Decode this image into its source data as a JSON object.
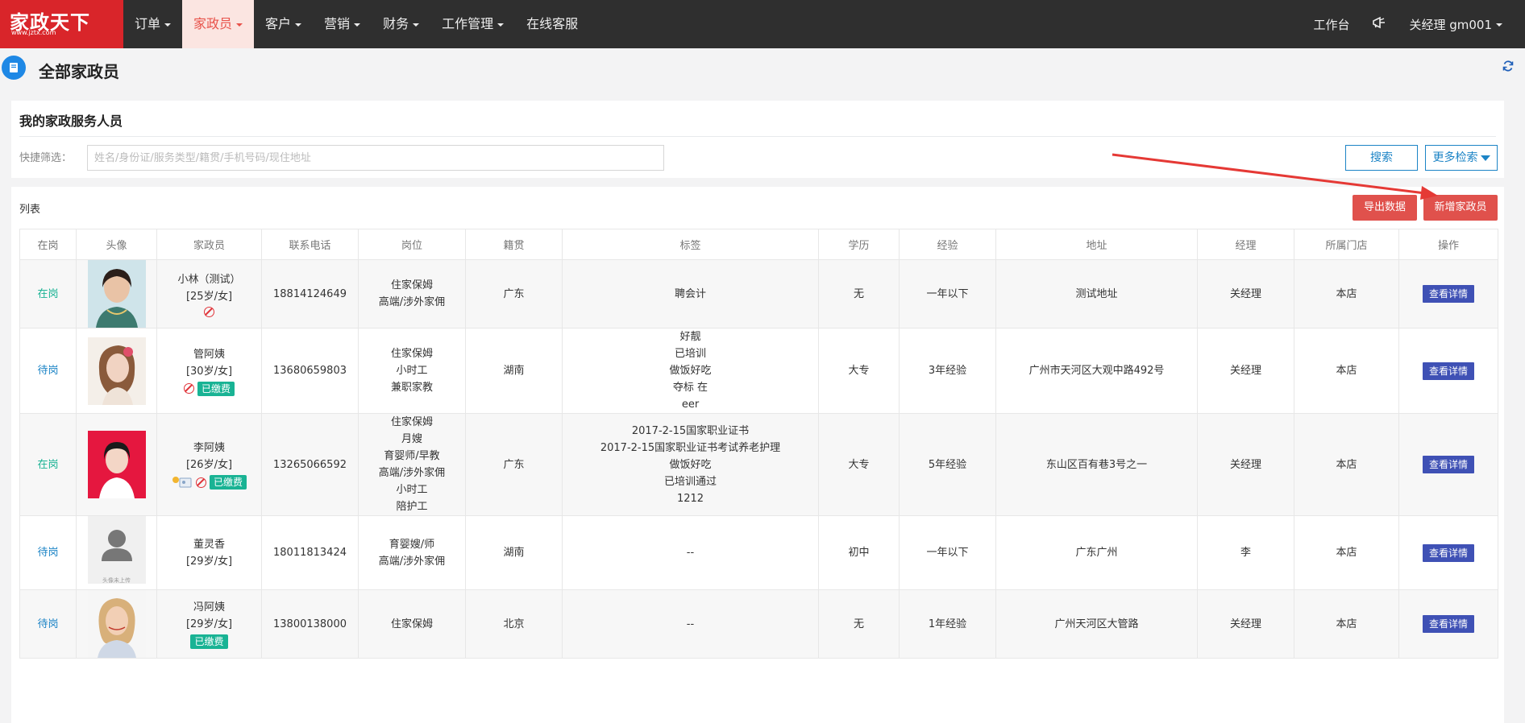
{
  "brand": {
    "logo_text": "家政天下",
    "logo_sub": "www.jztx.com",
    "colors": {
      "brand_red": "#d9252a",
      "nav_bg": "#2f2f2f",
      "accent_green": "#1ab394",
      "accent_blue": "#1c84c6",
      "detail_btn": "#3f51b5"
    }
  },
  "nav": {
    "items": [
      {
        "label": "订单",
        "dropdown": true
      },
      {
        "label": "家政员",
        "dropdown": true,
        "active": true
      },
      {
        "label": "客户",
        "dropdown": true
      },
      {
        "label": "营销",
        "dropdown": true
      },
      {
        "label": "财务",
        "dropdown": true
      },
      {
        "label": "工作管理",
        "dropdown": true
      },
      {
        "label": "在线客服",
        "dropdown": false
      }
    ],
    "right": {
      "workbench": "工作台",
      "bell_icon": "megaphone-icon",
      "user": "关经理 gm001"
    }
  },
  "page": {
    "title": "全部家政员",
    "icon": "book-icon",
    "refresh_icon": "refresh-icon"
  },
  "filter": {
    "title": "我的家政服务人员",
    "label": "快捷筛选：",
    "placeholder": "姓名/身份证/服务类型/籍贯/手机号码/现住地址",
    "search_btn": "搜索",
    "more_btn": "更多检索"
  },
  "list": {
    "label": "列表",
    "export_btn": "导出数据",
    "add_btn": "新增家政员",
    "columns": [
      "在岗",
      "头像",
      "家政员",
      "联系电话",
      "岗位",
      "籍贯",
      "标签",
      "学历",
      "经验",
      "地址",
      "经理",
      "所属门店",
      "操作"
    ],
    "rows": [
      {
        "status": "在岗",
        "name": "小林（测试）",
        "info": "[25岁/女]",
        "ban": true,
        "paid": "",
        "id_icon": false,
        "phone": "18814124649",
        "positions": [
          "住家保姆",
          "高端/涉外家佣"
        ],
        "origin": "广东",
        "tags": [
          "聘会计"
        ],
        "education": "无",
        "experience": "一年以下",
        "address": "测试地址",
        "manager": "关经理",
        "store": "本店",
        "action": "查看详情",
        "avatar": "woman-1"
      },
      {
        "status": "待岗",
        "name": "管阿姨",
        "info": "[30岁/女]",
        "ban": true,
        "paid": "已缴费",
        "id_icon": false,
        "phone": "13680659803",
        "positions": [
          "住家保姆",
          "小时工",
          "兼职家教"
        ],
        "origin": "湖南",
        "tags": [
          "好靓",
          "已培训",
          "做饭好吃",
          "夺标 在",
          "eer"
        ],
        "education": "大专",
        "experience": "3年经验",
        "address": "广州市天河区大观中路492号",
        "manager": "关经理",
        "store": "本店",
        "action": "查看详情",
        "avatar": "woman-2"
      },
      {
        "status": "在岗",
        "name": "李阿姨",
        "info": "[26岁/女]",
        "ban": true,
        "paid": "已缴费",
        "id_icon": true,
        "phone": "13265066592",
        "positions": [
          "住家保姆",
          "月嫂",
          "育婴师/早教",
          "高端/涉外家佣",
          "小时工",
          "陪护工"
        ],
        "origin": "广东",
        "tags": [
          "2017-2-15国家职业证书",
          "2017-2-15国家职业证书考试养老护理",
          "做饭好吃",
          "已培训通过",
          "1212"
        ],
        "education": "大专",
        "experience": "5年经验",
        "address": "东山区百有巷3号之一",
        "manager": "关经理",
        "store": "本店",
        "action": "查看详情",
        "avatar": "woman-3"
      },
      {
        "status": "待岗",
        "name": "董灵香",
        "info": "[29岁/女]",
        "ban": false,
        "paid": "",
        "id_icon": false,
        "phone": "18011813424",
        "positions": [
          "育婴嫂/师",
          "高端/涉外家佣"
        ],
        "origin": "湖南",
        "tags": [
          "--"
        ],
        "education": "初中",
        "experience": "一年以下",
        "address": "广东广州",
        "manager": "李",
        "store": "本店",
        "action": "查看详情",
        "avatar": "placeholder",
        "avatar_caption": "头像未上传"
      },
      {
        "status": "待岗",
        "name": "冯阿姨",
        "info": "[29岁/女]",
        "ban": false,
        "paid": "已缴费",
        "id_icon": false,
        "phone": "13800138000",
        "positions": [
          "住家保姆"
        ],
        "origin": "北京",
        "tags": [
          "--"
        ],
        "education": "无",
        "experience": "1年经验",
        "address": "广州天河区大管路",
        "manager": "关经理",
        "store": "本店",
        "action": "查看详情",
        "avatar": "woman-4"
      }
    ]
  }
}
